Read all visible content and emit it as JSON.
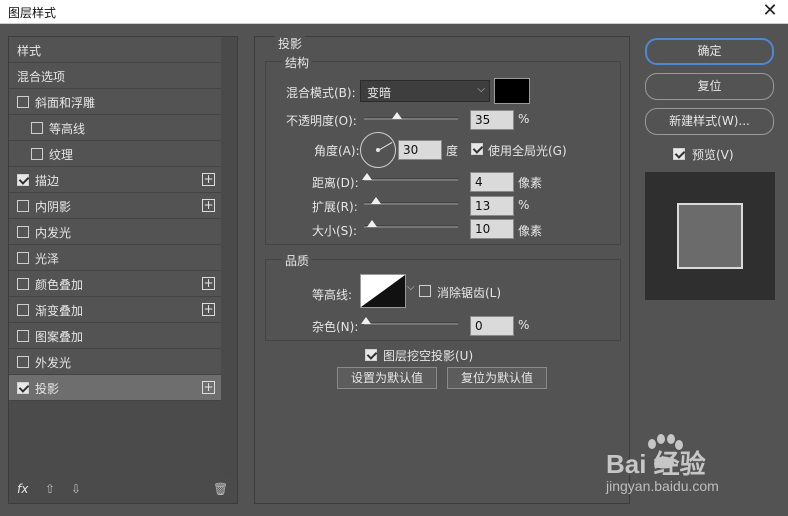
{
  "window": {
    "title": "图层样式",
    "close": "✕"
  },
  "left_panel": {
    "items": [
      {
        "label": "样式",
        "checkbox": false,
        "checked": false,
        "plus": false,
        "indent": false,
        "selected": false
      },
      {
        "label": "混合选项",
        "checkbox": false,
        "checked": false,
        "plus": false,
        "indent": false,
        "selected": false
      },
      {
        "label": "斜面和浮雕",
        "checkbox": true,
        "checked": false,
        "plus": false,
        "indent": false,
        "selected": false
      },
      {
        "label": "等高线",
        "checkbox": true,
        "checked": false,
        "plus": false,
        "indent": true,
        "selected": false
      },
      {
        "label": "纹理",
        "checkbox": true,
        "checked": false,
        "plus": false,
        "indent": true,
        "selected": false
      },
      {
        "label": "描边",
        "checkbox": true,
        "checked": true,
        "plus": true,
        "indent": false,
        "selected": false
      },
      {
        "label": "内阴影",
        "checkbox": true,
        "checked": false,
        "plus": true,
        "indent": false,
        "selected": false
      },
      {
        "label": "内发光",
        "checkbox": true,
        "checked": false,
        "plus": false,
        "indent": false,
        "selected": false
      },
      {
        "label": "光泽",
        "checkbox": true,
        "checked": false,
        "plus": false,
        "indent": false,
        "selected": false
      },
      {
        "label": "颜色叠加",
        "checkbox": true,
        "checked": false,
        "plus": true,
        "indent": false,
        "selected": false
      },
      {
        "label": "渐变叠加",
        "checkbox": true,
        "checked": false,
        "plus": true,
        "indent": false,
        "selected": false
      },
      {
        "label": "图案叠加",
        "checkbox": true,
        "checked": false,
        "plus": false,
        "indent": false,
        "selected": false
      },
      {
        "label": "外发光",
        "checkbox": true,
        "checked": false,
        "plus": false,
        "indent": false,
        "selected": false
      },
      {
        "label": "投影",
        "checkbox": true,
        "checked": true,
        "plus": true,
        "indent": false,
        "selected": true
      }
    ],
    "footer": {
      "fx": "fx",
      "up": "⇧",
      "down": "⇩",
      "trash": "🗑"
    }
  },
  "drop_shadow": {
    "section_title": "投影",
    "structure": {
      "title": "结构",
      "blend_mode_label": "混合模式(B):",
      "blend_mode_value": "变暗",
      "shadow_color": "#000000",
      "opacity_label": "不透明度(O):",
      "opacity_value": "35",
      "opacity_unit": "%",
      "angle_label": "角度(A):",
      "angle_value": "30",
      "angle_unit": "度",
      "global_light_label": "使用全局光(G)",
      "global_light_checked": true,
      "distance_label": "距离(D):",
      "distance_value": "4",
      "distance_unit": "像素",
      "spread_label": "扩展(R):",
      "spread_value": "13",
      "spread_unit": "%",
      "size_label": "大小(S):",
      "size_value": "10",
      "size_unit": "像素"
    },
    "quality": {
      "title": "品质",
      "contour_label": "等高线:",
      "anti_alias_label": "消除锯齿(L)",
      "anti_alias_checked": false,
      "noise_label": "杂色(N):",
      "noise_value": "0",
      "noise_unit": "%"
    },
    "knockout_label": "图层挖空投影(U)",
    "knockout_checked": true,
    "make_default_label": "设置为默认值",
    "reset_default_label": "复位为默认值"
  },
  "right_panel": {
    "ok_label": "确定",
    "reset_label": "复位",
    "new_style_label": "新建样式(W)...",
    "preview_label": "预览(V)",
    "preview_checked": true
  },
  "watermark": {
    "brand": "Bai 经验",
    "url": "jingyan.baidu.com"
  },
  "colors": {
    "panel_bg": "#535353",
    "accent": "#4d88d1",
    "selected_row": "#6e6e6e"
  }
}
